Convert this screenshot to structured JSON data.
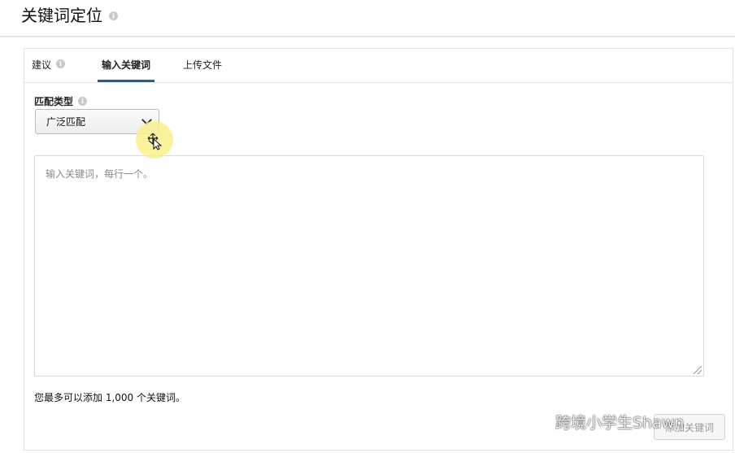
{
  "page": {
    "title": "关键词定位"
  },
  "tabs": [
    {
      "label": "建议",
      "active": false
    },
    {
      "label": "输入关键词",
      "active": true
    },
    {
      "label": "上传文件",
      "active": false
    }
  ],
  "match_type": {
    "label": "匹配类型",
    "selected": "广泛匹配"
  },
  "keywords_input": {
    "placeholder": "输入关键词，每行一个。",
    "value": ""
  },
  "limit_note": "您最多可以添加 1,000 个关键词。",
  "add_button": {
    "label": "添加关键词"
  },
  "watermark": {
    "text": "跨境小学生Shawn"
  },
  "colors": {
    "active_tab_underline": "#2f5d89",
    "cursor_highlight": "#faf08c"
  }
}
